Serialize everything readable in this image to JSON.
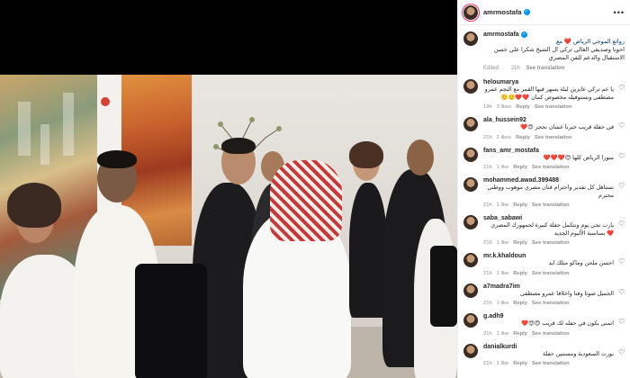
{
  "post": {
    "username": "amrmostafa",
    "caption_line1": "روائع الموجي الرياض ❤️ مع",
    "caption_line2": "اخونا وصديقي الغالي تركي ال الشيخ شكرا علي حسن الاستقبال والدعم للفن المصري",
    "edited": "Edited",
    "age": "21h",
    "see_translation": "See translation"
  },
  "comments": [
    {
      "user": "heloumarya",
      "text": "يا عم تركي عايزين ليلة يسهر فيها القمر مع النجم عمرو مصطفى ونستوفيله مخصوص كمان ❤️❤️🙂🙂",
      "age": "19h",
      "likes": "3 likes",
      "reply": "Reply",
      "see": "See translation"
    },
    {
      "user": "ala_hussein92",
      "text": "في حفلة قريب خبرنا عشان نحجز 😍❤️",
      "age": "21h",
      "likes": "2 likes",
      "reply": "Reply",
      "see": "See translation"
    },
    {
      "user": "fans_amr_mostafa",
      "text": "منورا الرياض كلها 😍❤️❤️❤️",
      "age": "21h",
      "likes": "1 like",
      "reply": "Reply",
      "see": "See translation"
    },
    {
      "user": "mohammed.awad.399488",
      "text": "تستاهل كل تقدير واحترام فنان مصري موهوب ووطني محترم",
      "age": "21h",
      "likes": "1 like",
      "reply": "Reply",
      "see": "See translation"
    },
    {
      "user": "saba_sabawi",
      "text": "يارب نجي يوم ونتكمل حفلة كبيرة لجمهورك المصري ❤️ بمناسبة الألبوم الجديد",
      "age": "21h",
      "likes": "1 like",
      "reply": "Reply",
      "see": "See translation"
    },
    {
      "user": "mr.k.khaldoun",
      "text": "احسن ملحن وماكو مثلك ابد",
      "age": "21h",
      "likes": "1 like",
      "reply": "Reply",
      "see": "See translation"
    },
    {
      "user": "a7madra7im",
      "text": "الجميل صوتا وفنا واخلاقا عمرو مصطفى",
      "age": "21h",
      "likes": "1 like",
      "reply": "Reply",
      "see": "See translation"
    },
    {
      "user": "g.adh9",
      "text": "اتمنى يكون في حفله لك قريب 😍😍❤️",
      "age": "21h",
      "likes": "1 like",
      "reply": "Reply",
      "see": "See translation"
    },
    {
      "user": "danialkurdi",
      "text": "نورت السعودية ومستنين حفلة",
      "age": "21h",
      "likes": "1 like",
      "reply": "Reply",
      "see": "See translation"
    }
  ]
}
